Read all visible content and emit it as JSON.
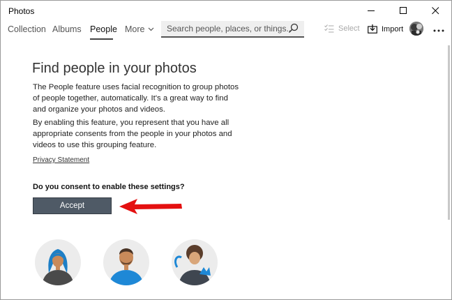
{
  "window": {
    "title": "Photos"
  },
  "nav": {
    "tabs": [
      {
        "label": "Collection"
      },
      {
        "label": "Albums"
      },
      {
        "label": "People"
      },
      {
        "label": "More"
      }
    ],
    "search_placeholder": "Search people, places, or things...",
    "select_label": "Select",
    "import_label": "Import"
  },
  "main": {
    "heading": "Find people in your photos",
    "paragraph1": "The People feature uses facial recognition to group photos of people together, automatically. It's a great way to find and organize your photos and videos.",
    "paragraph2": "By enabling this feature, you represent that you have all appropriate consents from the people in your photos and videos to use this grouping feature.",
    "privacy_link": "Privacy Statement",
    "question": "Do you consent to enable these settings?",
    "accept_label": "Accept"
  },
  "colors": {
    "accept_bg": "#4f5a66",
    "annotation_arrow": "#e41010"
  }
}
